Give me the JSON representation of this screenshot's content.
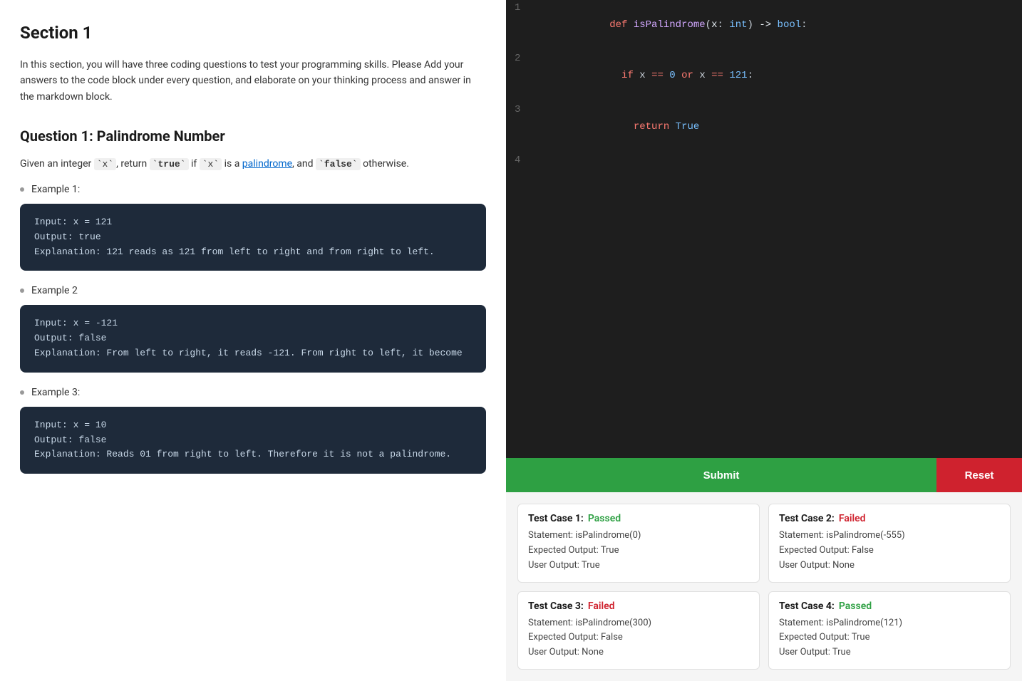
{
  "left": {
    "section_title": "Section 1",
    "intro": "In this section, you will have three coding questions to test your programming skills. Please Add your answers to the code block under every question, and elaborate on your thinking process and answer in the markdown block.",
    "question_title": "Question 1: Palindrome Number",
    "question_desc_parts": [
      {
        "type": "text",
        "value": "Given an integer "
      },
      {
        "type": "code",
        "value": "x"
      },
      {
        "type": "text",
        "value": ", return "
      },
      {
        "type": "code_bold",
        "value": "true"
      },
      {
        "type": "text",
        "value": " if "
      },
      {
        "type": "code",
        "value": "x"
      },
      {
        "type": "text",
        "value": " is a "
      },
      {
        "type": "link",
        "value": "palindrome",
        "href": "#"
      },
      {
        "type": "text",
        "value": ", and "
      },
      {
        "type": "code_bold",
        "value": "false"
      },
      {
        "type": "text",
        "value": " otherwise."
      }
    ],
    "examples": [
      {
        "label": "Example 1:",
        "code": "Input: x = 121\nOutput: true\nExplanation: 121 reads as 121 from left to right and from right to left."
      },
      {
        "label": "Example 2",
        "code": "Input: x = -121\nOutput: false\nExplanation: From left to right, it reads -121. From right to left, it become"
      },
      {
        "label": "Example 3:",
        "code": "Input: x = 10\nOutput: false\nExplanation: Reads 01 from right to left. Therefore it is not a palindrome."
      }
    ]
  },
  "editor": {
    "lines": [
      {
        "num": "1",
        "content": "def isPalindrome(x: int) -> bool:"
      },
      {
        "num": "2",
        "content": "  if x == 0 or x == 121:"
      },
      {
        "num": "3",
        "content": "    return True"
      },
      {
        "num": "4",
        "content": ""
      }
    ]
  },
  "buttons": {
    "submit": "Submit",
    "reset": "Reset"
  },
  "test_cases": [
    {
      "label": "Test Case 1:",
      "status": "Passed",
      "status_type": "passed",
      "statement": "Statement: isPalindrome(0)",
      "expected": "Expected Output: True",
      "user": "User Output: True"
    },
    {
      "label": "Test Case 2:",
      "status": "Failed",
      "status_type": "failed",
      "statement": "Statement: isPalindrome(-555)",
      "expected": "Expected Output: False",
      "user": "User Output: None"
    },
    {
      "label": "Test Case 3:",
      "status": "Failed",
      "status_type": "failed",
      "statement": "Statement: isPalindrome(300)",
      "expected": "Expected Output: False",
      "user": "User Output: None"
    },
    {
      "label": "Test Case 4:",
      "status": "Passed",
      "status_type": "passed",
      "statement": "Statement: isPalindrome(121)",
      "expected": "Expected Output: True",
      "user": "User Output: True"
    }
  ]
}
